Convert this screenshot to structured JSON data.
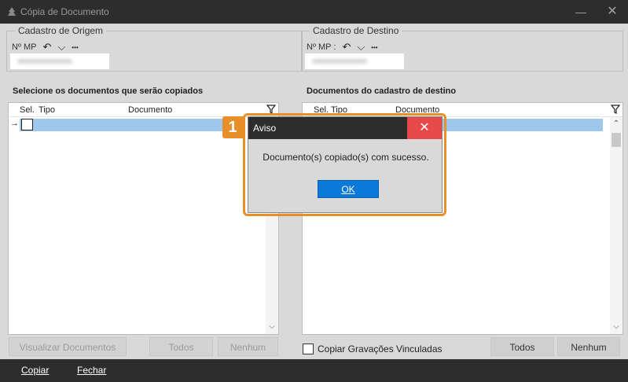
{
  "window": {
    "title": "Cópia de Documento",
    "minimize_glyph": "—",
    "close_glyph": "✕",
    "app_icon": "tree-icon"
  },
  "origem": {
    "legend": "Cadastro de Origem",
    "mp_label": "Nº MP",
    "undo_glyph": "↶",
    "chevron_glyph": "⌵",
    "more_glyph": "•••"
  },
  "destino": {
    "legend": "Cadastro de Destino",
    "mp_label": "Nº MP :",
    "undo_glyph": "↶",
    "chevron_glyph": "⌵",
    "more_glyph": "•••"
  },
  "left_panel": {
    "title": "Selecione os documentos que serão copiados",
    "columns": [
      "Sel.",
      "Tipo",
      "Documento"
    ],
    "row_pointer": "→",
    "scroll_down": "⌵"
  },
  "right_panel": {
    "title": "Documentos do cadastro de destino",
    "columns": [
      "Sel.",
      "Tipo",
      "Documento"
    ],
    "scroll_up": "⌃",
    "scroll_down": "⌵"
  },
  "left_buttons": {
    "visualizar": "Visualizar Documentos",
    "todos": "Todos",
    "nenhum": "Nenhum"
  },
  "right_buttons": {
    "copiar_gravacoes": "Copiar Gravações Vinculadas",
    "todos": "Todos",
    "nenhum": "Nenhum"
  },
  "bottom_bar": {
    "copiar": "Copiar",
    "fechar": "Fechar"
  },
  "dialog": {
    "step_number": "1",
    "title": "Aviso",
    "close_glyph": "✕",
    "message": "Documento(s) copiado(s) com sucesso.",
    "ok_label": "OK"
  },
  "colors": {
    "accent_orange": "#e88f2a",
    "ok_blue": "#0a78d7",
    "close_red": "#e5494a",
    "selection_blue": "#9fc8ec"
  }
}
